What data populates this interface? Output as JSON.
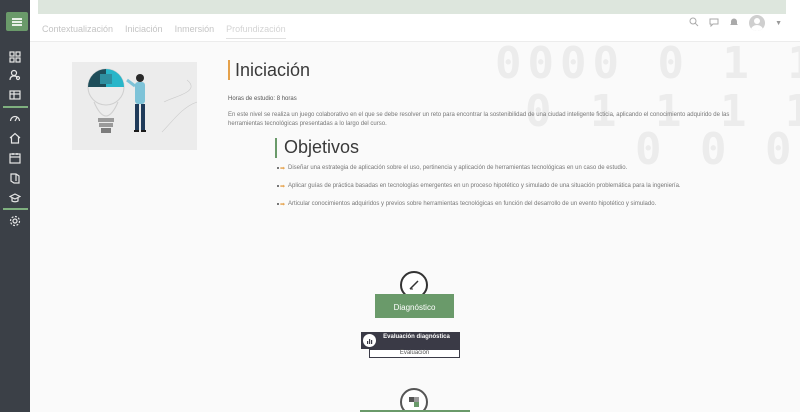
{
  "sidebar": {
    "menu_icon": "hamburger-icon",
    "items": [
      {
        "icon": "grid-icon"
      },
      {
        "icon": "user-search-icon"
      },
      {
        "icon": "table-icon"
      },
      {
        "icon": "dashboard-icon"
      },
      {
        "icon": "home-icon"
      },
      {
        "icon": "calendar-icon"
      },
      {
        "icon": "book-icon"
      },
      {
        "icon": "graduation-cap-icon"
      },
      {
        "icon": "settings-icon"
      }
    ],
    "accent": "#7fb07f"
  },
  "header": {
    "tabs": [
      "Contextualización",
      "Iniciación",
      "Inmersión",
      "Profundización"
    ],
    "active_tab_index": 3,
    "icons": [
      "search-icon",
      "chat-icon",
      "bell-icon",
      "avatar",
      "caret-icon"
    ]
  },
  "main": {
    "watermark_lines": [
      "0000 0 1 1",
      "0 1 1 1 1",
      "0 0 0"
    ],
    "title": "Iniciación",
    "hours": "Horas de estudio: 8 horas",
    "description": "En este nivel se realiza un juego colaborativo en el que se debe resolver un reto para encontrar la sostenibilidad de una ciudad inteligente ficticia, aplicando el conocimiento adquirido de las herramientas tecnológicas presentadas a lo largo del curso.",
    "objectives_title": "Objetivos",
    "objectives": [
      "Diseñar una estrategia de aplicación sobre el uso, pertinencia y aplicación de herramientas tecnológicas en un caso de estudio.",
      "Aplicar guías de práctica basadas en tecnologías emergentes en un proceso hipotético y simulado de una situación problemática para la ingeniería.",
      "Articular conocimientos adquiridos y previos sobre herramientas tecnológicas en función del desarrollo de un evento hipotético y simulado."
    ],
    "diagnostic_label": "Diagnóstico",
    "eval_card": {
      "title": "Evaluación diagnóstica",
      "subtitle": "Evaluación"
    }
  },
  "colors": {
    "primary_green": "#6a9a6a",
    "accent_orange": "#e5a14a",
    "sidebar_bg": "#3b4047"
  }
}
